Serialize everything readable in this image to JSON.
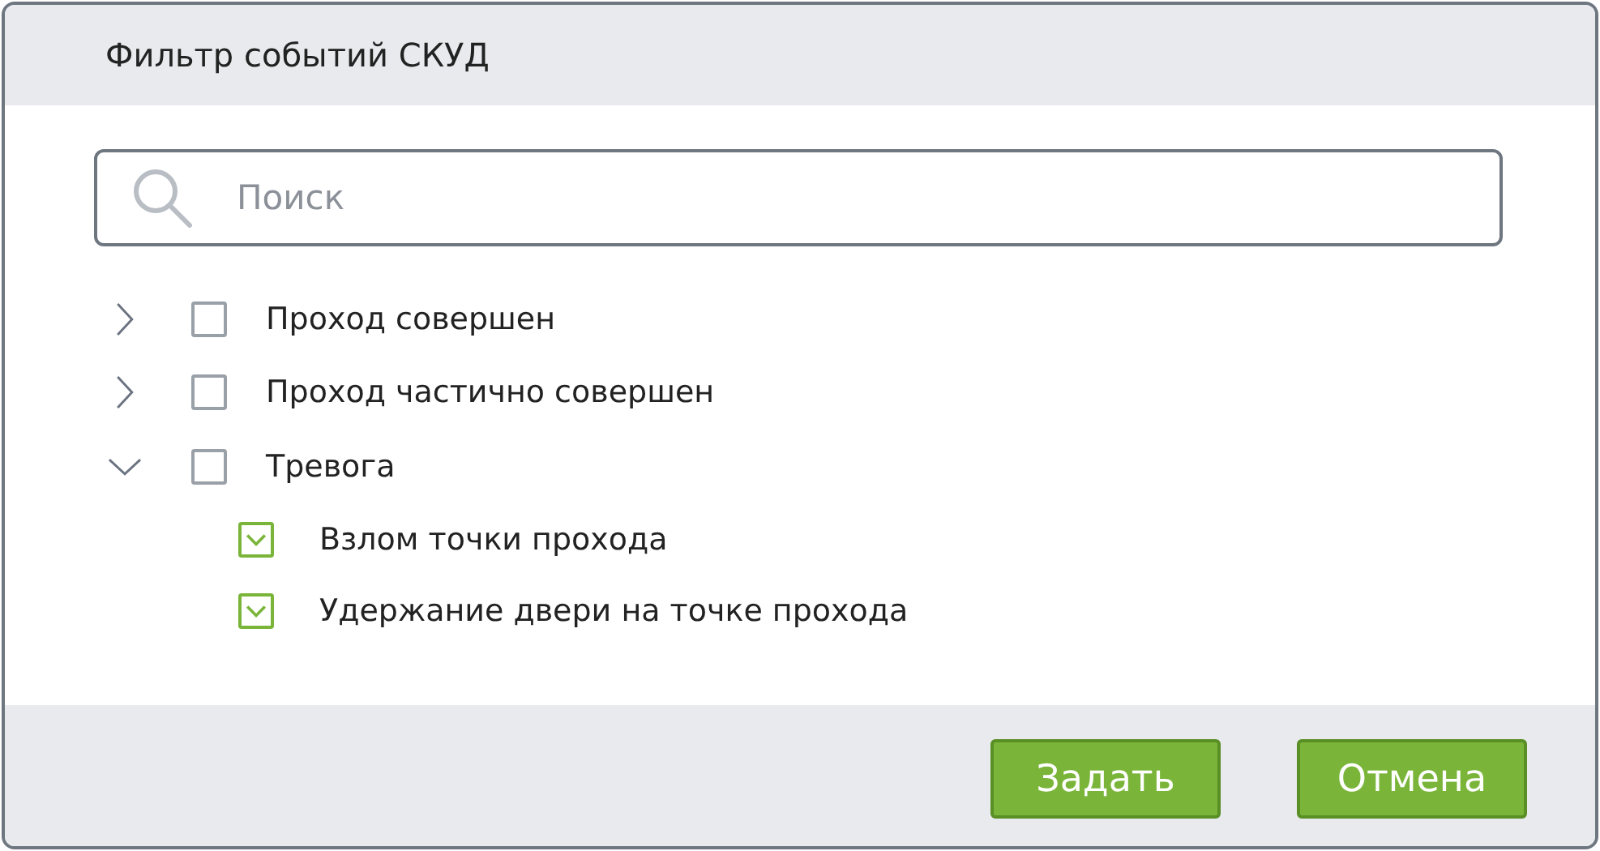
{
  "window": {
    "title": "Фильтр событий СКУД"
  },
  "search": {
    "placeholder": "Поиск"
  },
  "tree": [
    {
      "label": "Проход совершен",
      "expanded": false,
      "checked": false
    },
    {
      "label": "Проход частично совершен",
      "expanded": false,
      "checked": false
    },
    {
      "label": "Тревога",
      "expanded": true,
      "checked": false,
      "children": [
        {
          "label": "Взлом точки прохода",
          "checked": true
        },
        {
          "label": "Удержание двери на точке прохода",
          "checked": true
        }
      ]
    }
  ],
  "buttons": [
    "Задать",
    "Отмена"
  ]
}
